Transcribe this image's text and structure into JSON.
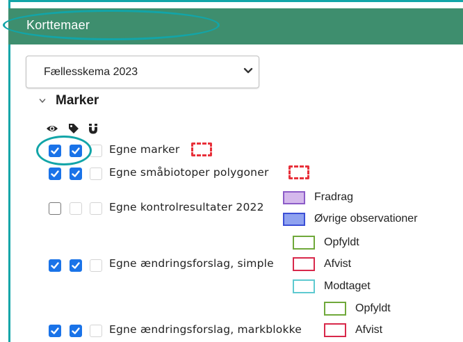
{
  "panel": {
    "title": "Korttemaer"
  },
  "year_select": {
    "value": "Fællesskema 2023"
  },
  "group": {
    "title": "Marker"
  },
  "column_icons": [
    "eye-icon",
    "tag-icon",
    "magnet-icon"
  ],
  "layers": [
    {
      "label": "Egne marker",
      "visible": true,
      "labels": true,
      "snap": false
    },
    {
      "label": "Egne småbiotoper polygoner",
      "visible": true,
      "labels": true,
      "snap": false
    },
    {
      "label": "Egne kontrolresultater 2022",
      "visible": false,
      "labels": false,
      "snap": false
    },
    {
      "label": "Egne ændringsforslag, simple",
      "visible": true,
      "labels": true,
      "snap": false
    },
    {
      "label": "Egne ændringsforslag, markblokke",
      "visible": true,
      "labels": true,
      "snap": false
    }
  ],
  "legend": {
    "fradrag": "Fradrag",
    "ovrige": "Øvrige observationer",
    "opfyldt_1": "Opfyldt",
    "afvist_1": "Afvist",
    "modtaget": "Modtaget",
    "opfyldt_2": "Opfyldt",
    "afvist_2": "Afvist"
  },
  "colors": {
    "header_bg": "#3e8e6e",
    "highlight": "#12a5a8",
    "checkbox_on": "#1a73e8",
    "marker_dashed": "#e8303a",
    "fradrag_fill": "#d4b8ec",
    "fradrag_border": "#8c5cc8",
    "ovrige_fill": "#8fa2f0",
    "ovrige_border": "#3b4fd6",
    "opfyldt": "#6fa83a",
    "afvist": "#d8284a",
    "modtaget": "#5ecad0"
  }
}
